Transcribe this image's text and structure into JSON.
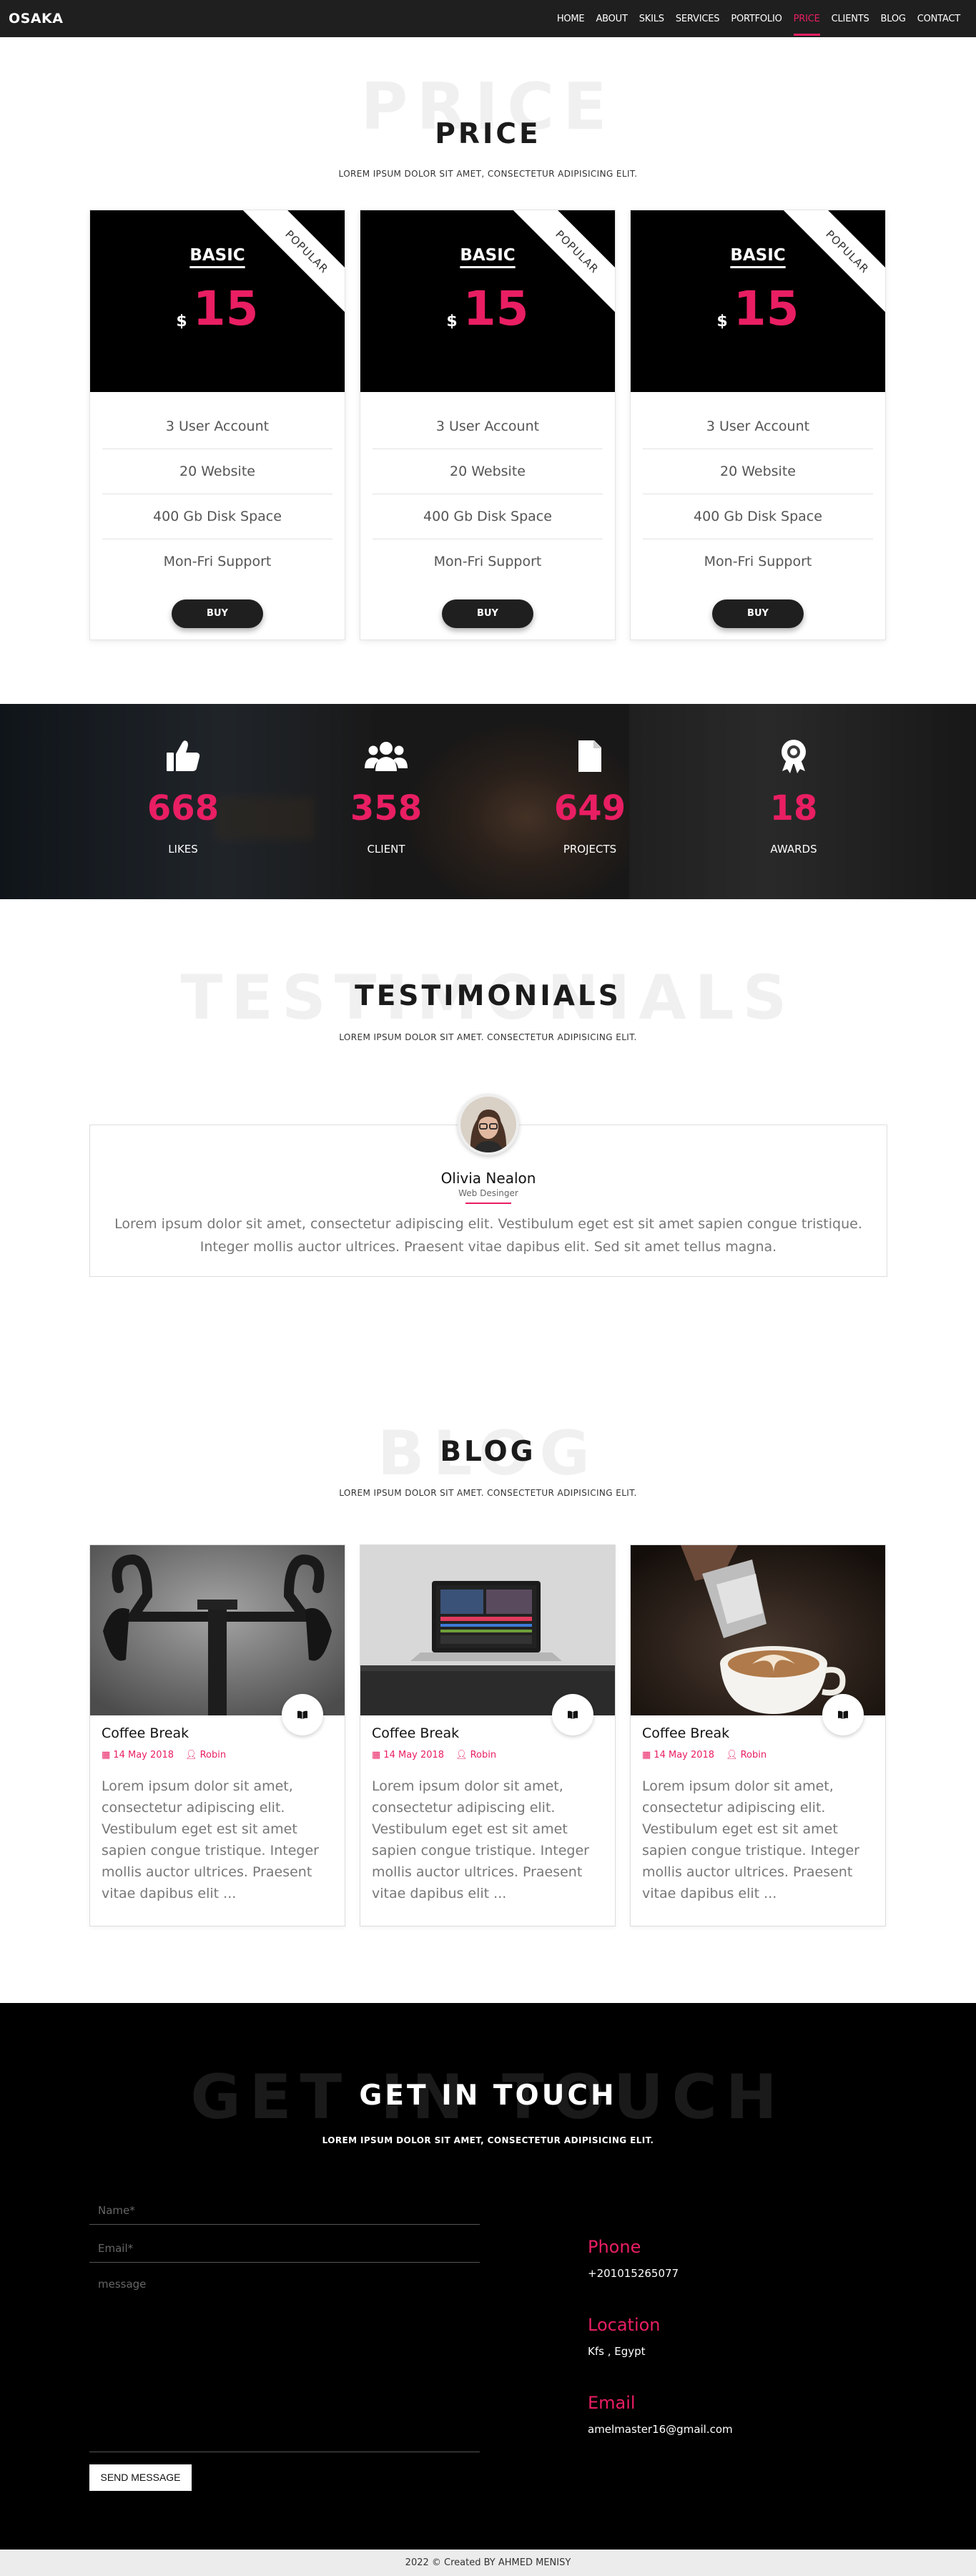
{
  "nav": {
    "logo": "OSAKA",
    "items": [
      "HOME",
      "ABOUT",
      "SKILS",
      "SERVICES",
      "PORTFOLIO",
      "PRICE",
      "CLIENTS",
      "BLOG",
      "CONTACT"
    ],
    "active": "PRICE",
    "accent": "#e91e63"
  },
  "price": {
    "ghost": "PRICE",
    "title": "PRICE",
    "subtitle": "LOREM IPSUM DOLOR SIT AMET, CONSECTETUR ADIPISICING ELIT.",
    "plans": [
      {
        "name": "BASIC",
        "currency": "$",
        "amount": "15",
        "ribbon": "POPULAR",
        "features": [
          "3 User Account",
          "20 Website",
          "400 Gb Disk Space",
          "Mon-Fri Support"
        ],
        "button": "BUY"
      },
      {
        "name": "BASIC",
        "currency": "$",
        "amount": "15",
        "ribbon": "POPULAR",
        "features": [
          "3 User Account",
          "20 Website",
          "400 Gb Disk Space",
          "Mon-Fri Support"
        ],
        "button": "BUY"
      },
      {
        "name": "BASIC",
        "currency": "$",
        "amount": "15",
        "ribbon": "POPULAR",
        "features": [
          "3 User Account",
          "20 Website",
          "400 Gb Disk Space",
          "Mon-Fri Support"
        ],
        "button": "BUY"
      }
    ]
  },
  "counters": [
    {
      "icon": "thumbs-up-icon",
      "value": "668",
      "label": "LIKES"
    },
    {
      "icon": "users-icon",
      "value": "358",
      "label": "CLIENT"
    },
    {
      "icon": "file-icon",
      "value": "649",
      "label": "PROJECTS"
    },
    {
      "icon": "award-icon",
      "value": "18",
      "label": "AWARDS"
    }
  ],
  "testimonials": {
    "ghost": "TESTIMONIALS",
    "title": "TESTIMONIALS",
    "subtitle": "LOREM IPSUM DOLOR SIT AMET. CONSECTETUR ADIPISICING ELIT.",
    "name": "Olivia Nealon",
    "role": "Web Desinger",
    "text": "Lorem ipsum dolor sit amet, consectetur adipiscing elit. Vestibulum eget est sit amet sapien congue tristique. Integer mollis auctor ultrices. Praesent vitae dapibus elit. Sed sit amet tellus magna."
  },
  "blog": {
    "ghost": "BLOG",
    "title": "BLOG",
    "subtitle": "LOREM IPSUM DOLOR SIT AMET. CONSECTETUR ADIPISICING ELIT.",
    "posts": [
      {
        "title": "Coffee Break",
        "date": "14 May 2018",
        "author": "Robin",
        "text": "Lorem ipsum dolor sit amet, consectetur adipiscing elit. Vestibulum eget est sit amet sapien congue tristique. Integer mollis auctor ultrices. Praesent vitae dapibus elit ...",
        "image": "bicycle-handlebar-photo"
      },
      {
        "title": "Coffee Break",
        "date": "14 May 2018",
        "author": "Robin",
        "text": "Lorem ipsum dolor sit amet, consectetur adipiscing elit. Vestibulum eget est sit amet sapien congue tristique. Integer mollis auctor ultrices. Praesent vitae dapibus elit ...",
        "image": "laptop-photo"
      },
      {
        "title": "Coffee Break",
        "date": "14 May 2018",
        "author": "Robin",
        "text": "Lorem ipsum dolor sit amet, consectetur adipiscing elit. Vestibulum eget est sit amet sapien congue tristique. Integer mollis auctor ultrices. Praesent vitae dapibus elit ...",
        "image": "latte-art-photo"
      }
    ]
  },
  "contact": {
    "ghost": "GET IN TOUCH",
    "title": "GET IN TOUCH",
    "subtitle": "LOREM IPSUM DOLOR SIT AMET, CONSECTETUR ADIPISICING ELIT.",
    "name_placeholder": "Name*",
    "email_placeholder": "Email*",
    "message_placeholder": "message",
    "send": "SEND MESSAGE",
    "phone_label": "Phone",
    "phone": "+201015265077",
    "location_label": "Location",
    "location": "Kfs , Egypt",
    "email_label": "Email",
    "email": "amelmaster16@gmail.com"
  },
  "footer": {
    "text": "2022 © Created BY AHMED MENISY"
  }
}
